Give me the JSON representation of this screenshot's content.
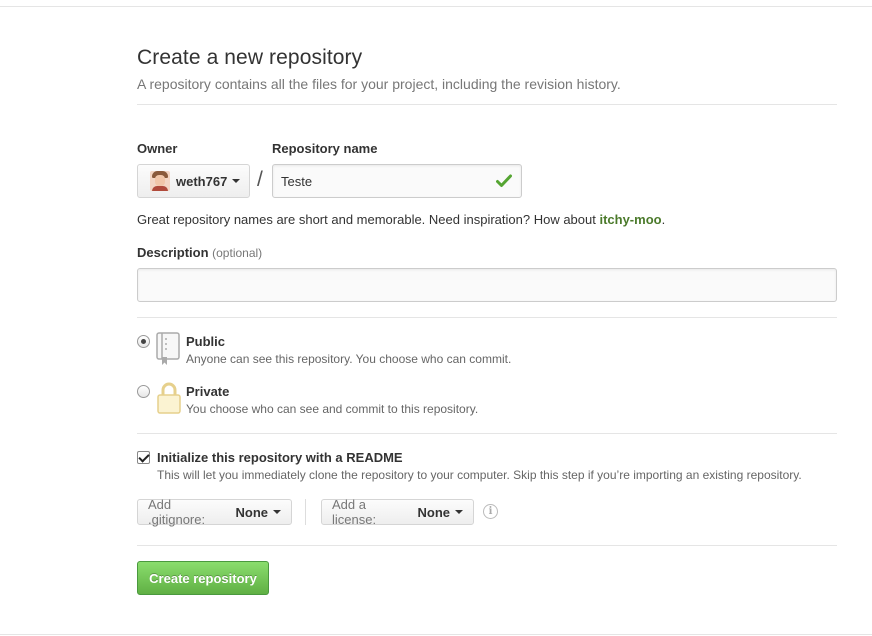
{
  "header": {
    "title": "Create a new repository",
    "subtitle": "A repository contains all the files for your project, including the revision history."
  },
  "owner": {
    "label": "Owner",
    "name": "weth767"
  },
  "repo": {
    "label": "Repository name",
    "separator": "/",
    "value": "Teste",
    "valid": true
  },
  "hint": {
    "text": "Great repository names are short and memorable. Need inspiration? How about ",
    "suggestion": "itchy-moo",
    "end": "."
  },
  "description": {
    "label": "Description",
    "optional": "(optional)",
    "value": ""
  },
  "visibility": {
    "selected": "public",
    "public": {
      "title": "Public",
      "desc": "Anyone can see this repository. You choose who can commit.",
      "icon": "repo-icon"
    },
    "private": {
      "title": "Private",
      "desc": "You choose who can see and commit to this repository.",
      "icon": "lock-icon"
    }
  },
  "init": {
    "checked": true,
    "title": "Initialize this repository with a README",
    "desc": "This will let you immediately clone the repository to your computer. Skip this step if you’re importing an existing repository."
  },
  "gitignore": {
    "label": "Add .gitignore:",
    "value": "None"
  },
  "license": {
    "label": "Add a license:",
    "value": "None"
  },
  "info_icon": "i",
  "submit": {
    "label": "Create repository"
  },
  "colors": {
    "accent_green": "#60b044",
    "suggestion_green": "#4b7a2b",
    "check_green": "#55a532",
    "lock_yellow": "#e6d08c"
  }
}
